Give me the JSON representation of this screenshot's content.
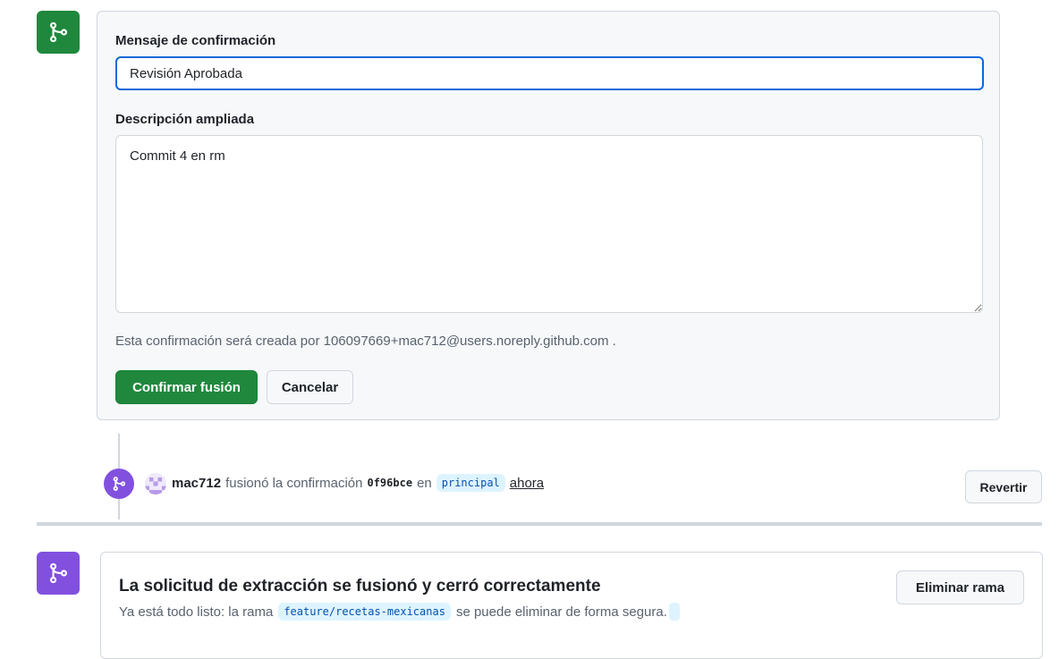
{
  "form": {
    "message_label": "Mensaje de confirmación",
    "message_value": "Revisión Aprobada",
    "description_label": "Descripción ampliada",
    "description_value": "Commit 4 en rm",
    "author_note": "Esta confirmación será creada por 106097669+mac712@users.noreply.github.com .",
    "confirm_button": "Confirmar fusión",
    "cancel_button": "Cancelar"
  },
  "event": {
    "user": "mac712",
    "action": "fusionó la confirmación",
    "sha": "0f96bce",
    "preposition": "en",
    "branch": "principal",
    "time": "ahora",
    "revert_button": "Revertir"
  },
  "status": {
    "title": "La solicitud de extracción se fusionó y cerró correctamente",
    "subtitle_prefix": "Ya está todo listo: la rama",
    "branch": "feature/recetas-mexicanas",
    "subtitle_suffix": "se puede eliminar de forma segura.",
    "delete_button": "Eliminar rama"
  },
  "icons": {
    "merge_badge_top": "git-merge-icon",
    "merge_event": "git-merge-icon",
    "merge_badge_bottom": "git-merge-icon",
    "avatar": "identicon-avatar"
  },
  "colors": {
    "green": "#1f883d",
    "purple": "#8250df",
    "focus_blue": "#0969da"
  }
}
